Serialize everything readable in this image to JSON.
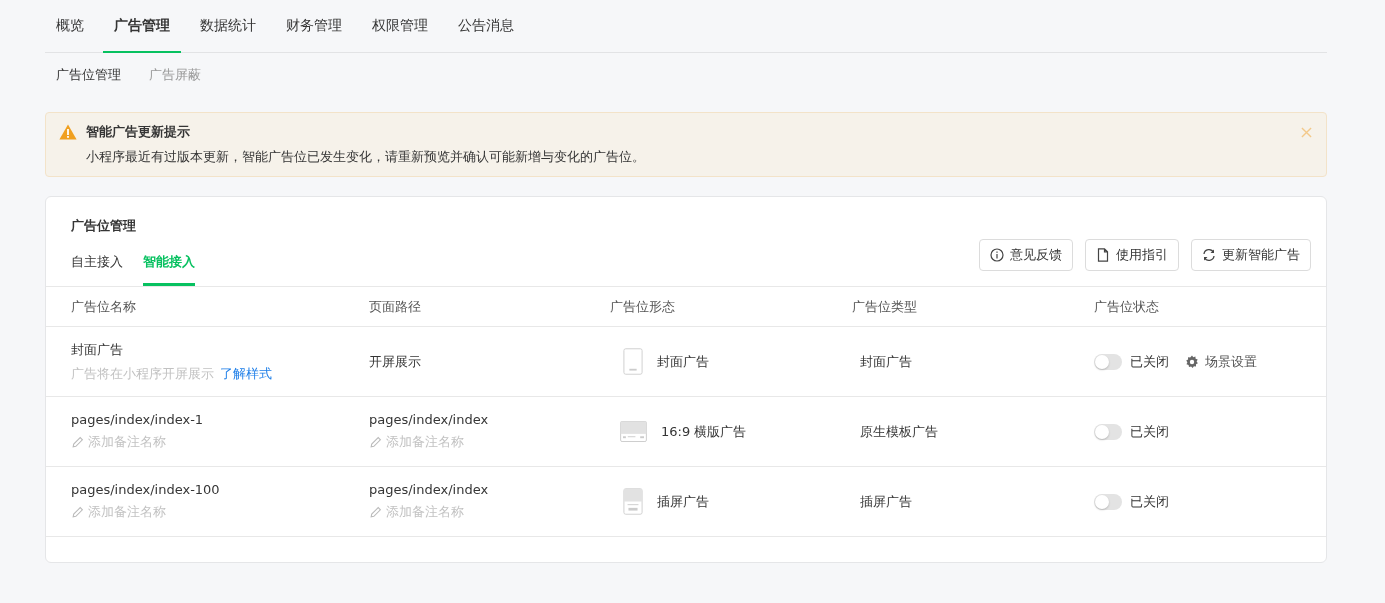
{
  "top_tabs": [
    {
      "label": "概览",
      "selected": false
    },
    {
      "label": "广告管理",
      "selected": true
    },
    {
      "label": "数据统计",
      "selected": false
    },
    {
      "label": "财务管理",
      "selected": false
    },
    {
      "label": "权限管理",
      "selected": false
    },
    {
      "label": "公告消息",
      "selected": false
    }
  ],
  "sub_tabs": [
    {
      "label": "广告位管理",
      "selected": true
    },
    {
      "label": "广告屏蔽",
      "selected": false
    }
  ],
  "alert": {
    "title": "智能广告更新提示",
    "message": "小程序最近有过版本更新，智能广告位已发生变化，请重新预览并确认可能新增与变化的广告位。"
  },
  "card": {
    "title": "广告位管理",
    "tabs": [
      {
        "label": "自主接入",
        "selected": false
      },
      {
        "label": "智能接入",
        "selected": true
      }
    ],
    "buttons": [
      {
        "kind": "info",
        "label": "意见反馈"
      },
      {
        "kind": "doc",
        "label": "使用指引"
      },
      {
        "kind": "refresh",
        "label": "更新智能广告"
      }
    ],
    "columns": [
      "广告位名称",
      "页面路径",
      "广告位形态",
      "广告位类型",
      "广告位状态"
    ],
    "rows": [
      {
        "name": "封面广告",
        "note": "广告将在小程序开屏展示",
        "link": "了解样式",
        "path": "开屏展示",
        "format": {
          "kind": "splash",
          "label": "封面广告"
        },
        "type": "封面广告",
        "status": {
          "on": false,
          "label": "已关闭"
        },
        "action": "场景设置"
      },
      {
        "name": "pages/index/index-1",
        "remark": "添加备注名称",
        "path": "pages/index/index",
        "path_remark": "添加备注名称",
        "format": {
          "kind": "banner",
          "label": "16:9 横版广告"
        },
        "type": "原生模板广告",
        "status": {
          "on": false,
          "label": "已关闭"
        }
      },
      {
        "name": "pages/index/index-100",
        "remark": "添加备注名称",
        "path": "pages/index/index",
        "path_remark": "添加备注名称",
        "format": {
          "kind": "interstitial",
          "label": "插屏广告"
        },
        "type": "插屏广告",
        "status": {
          "on": false,
          "label": "已关闭"
        }
      }
    ]
  }
}
